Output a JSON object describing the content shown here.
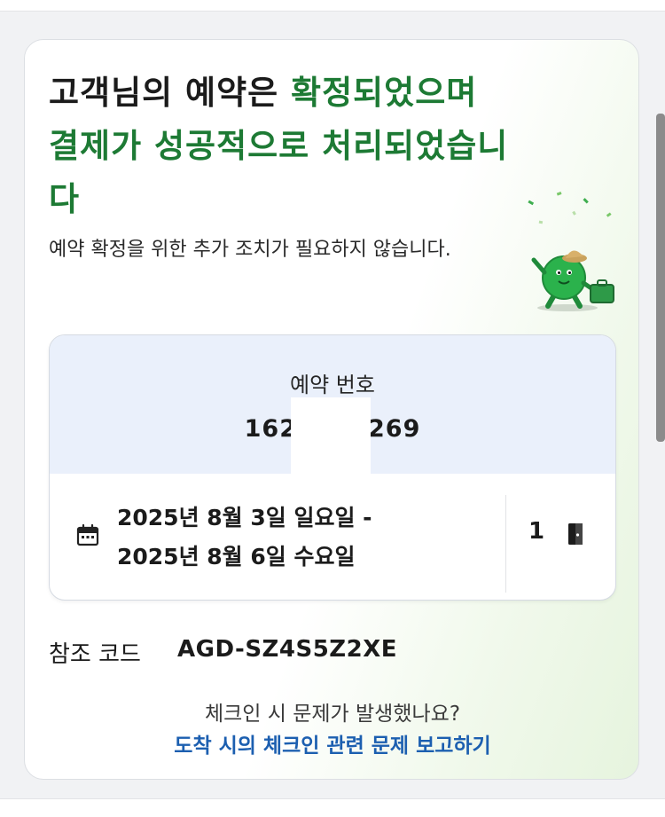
{
  "confirmation": {
    "headline_black": "고객님의 예약은 ",
    "headline_green": "확정되었으며 결제가 성공적으로 처리되었습니다",
    "subtext": "예약 확정을 위한 추가 조치가 필요하지 않습니다."
  },
  "booking": {
    "number_label": "예약 번호",
    "number_prefix": "162",
    "number_suffix": "269",
    "date_start": "2025년 8월 3일 일요일 -",
    "date_end": "2025년 8월 6일 수요일",
    "room_count": "1"
  },
  "reference": {
    "label": "참조 코드",
    "code": "AGD-SZ4S5Z2XE"
  },
  "help": {
    "question": "체크인 시 문제가 발생했나요?",
    "link": "도착 시의 체크인 관련 문제 보고하기"
  },
  "colors": {
    "headline_green": "#1d7a34",
    "link_blue": "#1c5fb0",
    "booking_header_bg": "#eaf0fb",
    "mascot_green": "#2bb24c"
  },
  "icons": [
    "calendar-icon",
    "door-icon",
    "mascot-illustration"
  ]
}
